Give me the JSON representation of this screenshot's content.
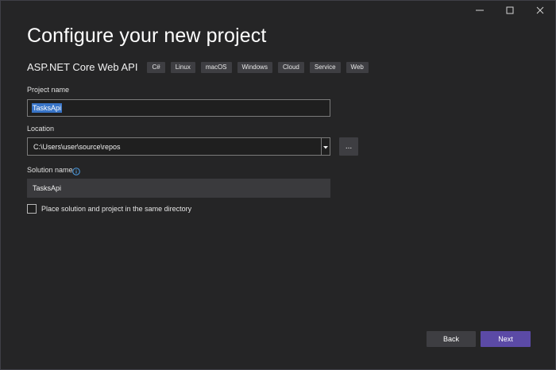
{
  "window": {
    "controls": {
      "minimize_icon": "minimize-icon",
      "maximize_icon": "maximize-icon",
      "close_icon": "close-icon"
    }
  },
  "header": {
    "title": "Configure your new project"
  },
  "template": {
    "name": "ASP.NET Core Web API",
    "tags": [
      "C#",
      "Linux",
      "macOS",
      "Windows",
      "Cloud",
      "Service",
      "Web"
    ]
  },
  "form": {
    "project_name": {
      "label": "Project name",
      "value": "TasksApi",
      "selected": true
    },
    "location": {
      "label": "Location",
      "value": "C:\\Users\\user\\source\\repos",
      "browse_label": "..."
    },
    "solution_name": {
      "label": "Solution name",
      "info_icon": "info-icon",
      "value": "TasksApi"
    },
    "same_directory": {
      "label": "Place solution and project in the same directory",
      "checked": false
    }
  },
  "footer": {
    "back_label": "Back",
    "next_label": "Next"
  },
  "colors": {
    "background": "#252526",
    "input_bg": "#1f1f1f",
    "disabled_input_bg": "#3a3a3d",
    "tag_bg": "#3e3e42",
    "selection": "#3874c7",
    "primary_button": "#5b4aa6",
    "secondary_button": "#3e3e42",
    "info_icon": "#4ea0e8"
  }
}
